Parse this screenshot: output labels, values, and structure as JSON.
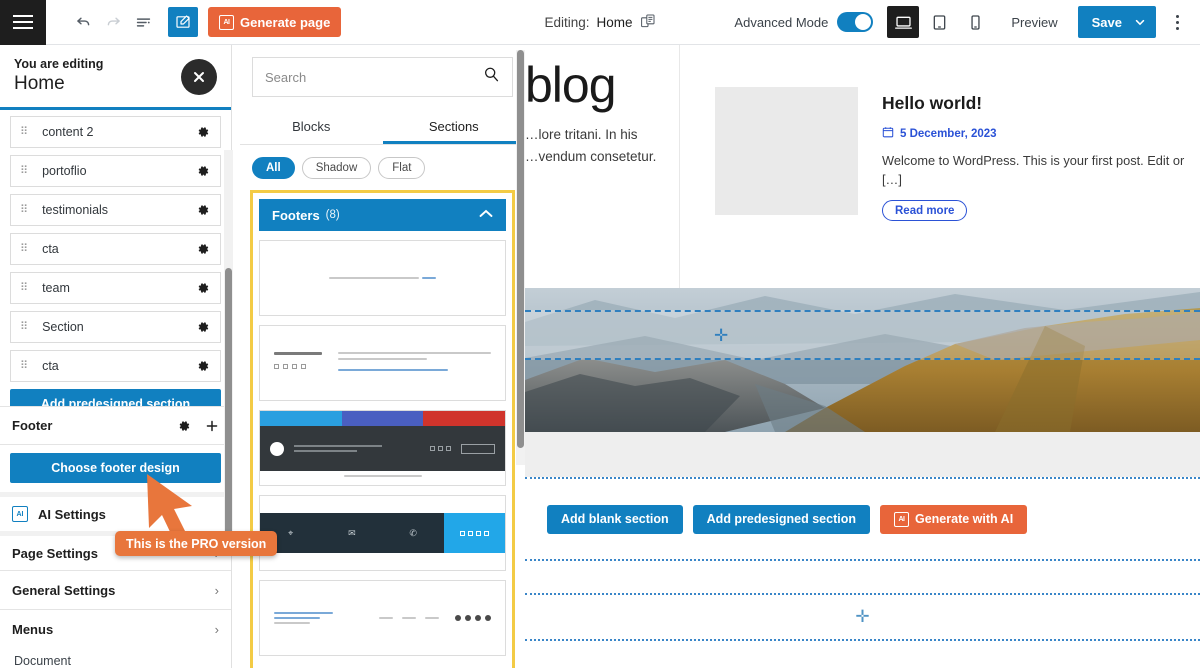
{
  "toolbar": {
    "menu_icon": "hamburger-icon",
    "undo_icon": "undo-arrow-icon",
    "redo_icon": "redo-arrow-icon",
    "list_view_icon": "list-view-icon",
    "edit_icon": "edit-pencil-icon",
    "generate_page_label": "Generate page",
    "ai_badge": "AI",
    "editing_label": "Editing:",
    "editing_page": "Home",
    "page_switch_icon": "page-switch-icon",
    "advanced_mode_label": "Advanced Mode",
    "advanced_mode_on": true,
    "device_desktop_icon": "desktop-icon",
    "device_tablet_icon": "tablet-icon",
    "device_mobile_icon": "mobile-icon",
    "preview_label": "Preview",
    "save_label": "Save",
    "save_chevron_icon": "chevron-down-icon",
    "more_icon": "kebab-menu-icon",
    "accent_blue": "#1180c0",
    "accent_orange": "#e8653a"
  },
  "sidebar": {
    "eyebrow": "You are editing",
    "page_title": "Home",
    "close_icon": "close-x-icon",
    "sections": [
      {
        "label": "content 2"
      },
      {
        "label": "portoflio"
      },
      {
        "label": "testimonials"
      },
      {
        "label": "cta"
      },
      {
        "label": "team"
      },
      {
        "label": "Section"
      },
      {
        "label": "cta"
      }
    ],
    "drag_icon": "drag-handle-icon",
    "settings_icon": "gear-icon",
    "add_predesigned_label": "Add predesigned section",
    "footer_group": {
      "label": "Footer",
      "gear_icon": "gear-icon",
      "plus_icon": "plus-icon",
      "choose_design_label": "Choose footer design"
    },
    "menu_rows": [
      {
        "label": "AI Settings",
        "icon": "ai-icon",
        "chevron": ""
      },
      {
        "label": "Page Settings",
        "icon": "",
        "chevron": "›"
      },
      {
        "label": "General Settings",
        "icon": "",
        "chevron": "›"
      },
      {
        "label": "Menus",
        "icon": "",
        "chevron": "›"
      }
    ],
    "document_label": "Document",
    "pro_tooltip": "This is the PRO version",
    "cursor_icon": "mouse-pointer-arrow"
  },
  "library": {
    "search_placeholder": "Search",
    "search_value": "",
    "search_icon": "search-icon",
    "tabs": [
      {
        "label": "Blocks",
        "active": false
      },
      {
        "label": "Sections",
        "active": true
      }
    ],
    "filters": [
      {
        "label": "All",
        "active": true
      },
      {
        "label": "Shadow",
        "active": false
      },
      {
        "label": "Flat",
        "active": false
      }
    ],
    "group": {
      "name": "Footers",
      "count": "(8)",
      "collapse_icon": "chevron-up-icon",
      "expanded": true
    },
    "thumbnails": [
      {
        "name": "footer-simple-copyright"
      },
      {
        "name": "footer-company-social"
      },
      {
        "name": "footer-social-bars-dark"
      },
      {
        "name": "footer-contact-columns"
      },
      {
        "name": "footer-links-social-row"
      }
    ],
    "highlight_color": "#f3cb45"
  },
  "preview": {
    "hero_title": "blog",
    "hero_text_line1": "…lore tritani. In his",
    "hero_text_line2": "…vendum consetetur.",
    "post": {
      "title": "Hello world!",
      "date": "5 December, 2023",
      "date_icon": "calendar-icon",
      "excerpt": "Welcome to WordPress. This is your first post. Edit or […]",
      "read_more_label": "Read more",
      "link_color": "#2b52d6"
    },
    "image_alt": "mountain-landscape-photo",
    "selection_plus_icon": "plus-marker-icon",
    "actions": [
      {
        "label": "Add blank section",
        "style": "blue"
      },
      {
        "label": "Add predesigned section",
        "style": "blue"
      },
      {
        "label": "Generate with AI",
        "style": "orange",
        "icon": "ai-icon"
      }
    ],
    "add_plus_icon": "plus-icon"
  }
}
